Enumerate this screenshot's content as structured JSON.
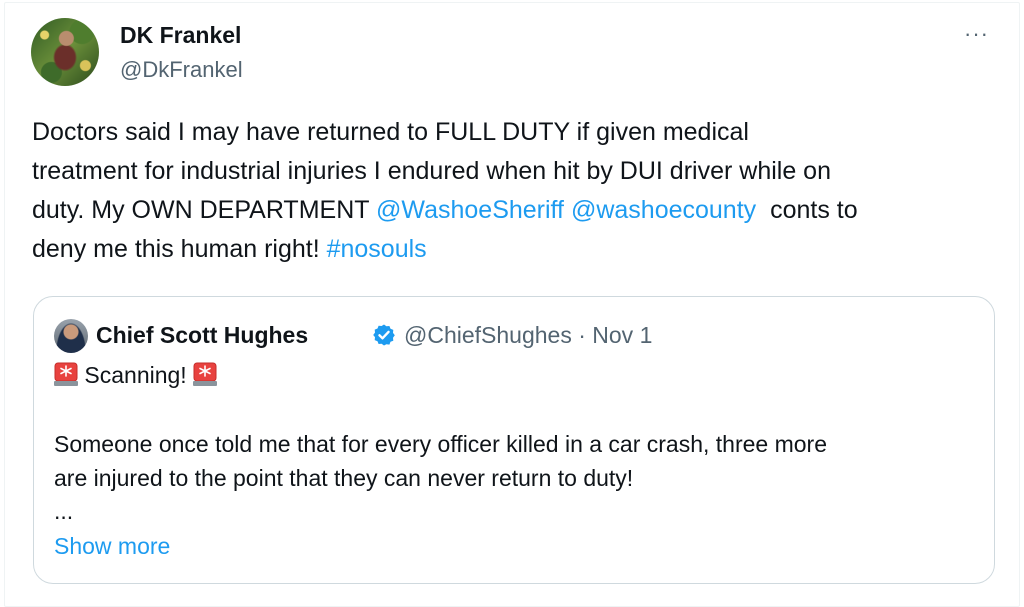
{
  "author": {
    "name": "DK Frankel",
    "handle": "@DkFrankel"
  },
  "more_icon": "···",
  "tweet": {
    "line1": "Doctors said I may have returned to FULL DUTY if given medical",
    "line2": "treatment for industrial injuries I endured when hit by DUI driver while on",
    "line3_a": "duty. My OWN DEPARTMENT ",
    "mention1": "@WashoeSheriff",
    "mention2": "@washoecounty",
    "line3_b": "  conts to",
    "line4_a": "deny me this human right! ",
    "hashtag": "#nosouls"
  },
  "quoted": {
    "name": "Chief Scott Hughes",
    "handle_date": "@ChiefShughes · Nov 1",
    "scanning": " Scanning! ",
    "body_line1": "Someone once told me that for every officer killed in a car crash, three more",
    "body_line2": "are injured to the point that they can never return to duty!",
    "ellipsis": "...",
    "show_more": "Show more"
  },
  "colors": {
    "link": "#1d9bf0",
    "secondary_text": "#536471",
    "verified_badge": "#1d9bf0"
  }
}
